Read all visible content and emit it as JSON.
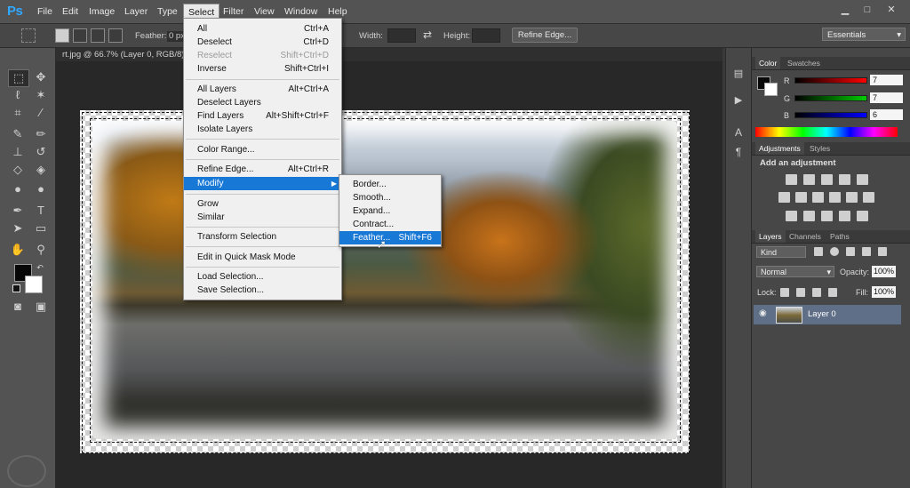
{
  "app": {
    "logo": "Ps"
  },
  "menubar": {
    "items": [
      "File",
      "Edit",
      "Image",
      "Layer",
      "Type",
      "Select",
      "Filter",
      "View",
      "Window",
      "Help"
    ],
    "active": "Select"
  },
  "window_controls": {
    "minimize": "▁",
    "restore": "□",
    "close": "✕"
  },
  "options_bar": {
    "feather_label": "Feather:",
    "feather_value": "0 px",
    "width_label": "Width:",
    "height_label": "Height:",
    "refine_edge": "Refine Edge...",
    "workspace": "Essentials"
  },
  "document": {
    "tab_label": "rt.jpg @ 66.7% (Layer 0, RGB/8)"
  },
  "select_menu": {
    "items": [
      {
        "label": "All",
        "shortcut": "Ctrl+A"
      },
      {
        "label": "Deselect",
        "shortcut": "Ctrl+D"
      },
      {
        "label": "Reselect",
        "shortcut": "Shift+Ctrl+D",
        "disabled": true
      },
      {
        "label": "Inverse",
        "shortcut": "Shift+Ctrl+I"
      },
      {
        "label": "All Layers",
        "shortcut": "Alt+Ctrl+A"
      },
      {
        "label": "Deselect Layers",
        "shortcut": ""
      },
      {
        "label": "Find Layers",
        "shortcut": "Alt+Shift+Ctrl+F"
      },
      {
        "label": "Isolate Layers",
        "shortcut": ""
      },
      {
        "label": "Color Range...",
        "shortcut": ""
      },
      {
        "label": "Refine Edge...",
        "shortcut": "Alt+Ctrl+R"
      },
      {
        "label": "Modify",
        "shortcut": ""
      },
      {
        "label": "Grow",
        "shortcut": ""
      },
      {
        "label": "Similar",
        "shortcut": ""
      },
      {
        "label": "Transform Selection",
        "shortcut": ""
      },
      {
        "label": "Edit in Quick Mask Mode",
        "shortcut": ""
      },
      {
        "label": "Load Selection...",
        "shortcut": ""
      },
      {
        "label": "Save Selection...",
        "shortcut": ""
      }
    ]
  },
  "modify_submenu": {
    "items": [
      {
        "label": "Border...",
        "shortcut": ""
      },
      {
        "label": "Smooth...",
        "shortcut": ""
      },
      {
        "label": "Expand...",
        "shortcut": ""
      },
      {
        "label": "Contract...",
        "shortcut": ""
      },
      {
        "label": "Feather...",
        "shortcut": "Shift+F6"
      }
    ],
    "highlighted": "Feather..."
  },
  "color_panel": {
    "tabs": [
      "Color",
      "Swatches"
    ],
    "r_label": "R",
    "g_label": "G",
    "b_label": "B",
    "r_value": "7",
    "g_value": "7",
    "b_value": "6"
  },
  "adjustments_panel": {
    "tabs": [
      "Adjustments",
      "Styles"
    ],
    "heading": "Add an adjustment"
  },
  "layers_panel": {
    "tabs": [
      "Layers",
      "Channels",
      "Paths"
    ],
    "filter_kind": "Kind",
    "blend_mode": "Normal",
    "opacity_label": "Opacity:",
    "opacity_value": "100%",
    "lock_label": "Lock:",
    "fill_label": "Fill:",
    "fill_value": "100%",
    "layers": [
      {
        "name": "Layer 0",
        "visible": true
      }
    ]
  },
  "colors": {
    "highlight": "#1878d6",
    "layer_selected": "#5f6f88",
    "ps_blue": "#31a8ff"
  }
}
